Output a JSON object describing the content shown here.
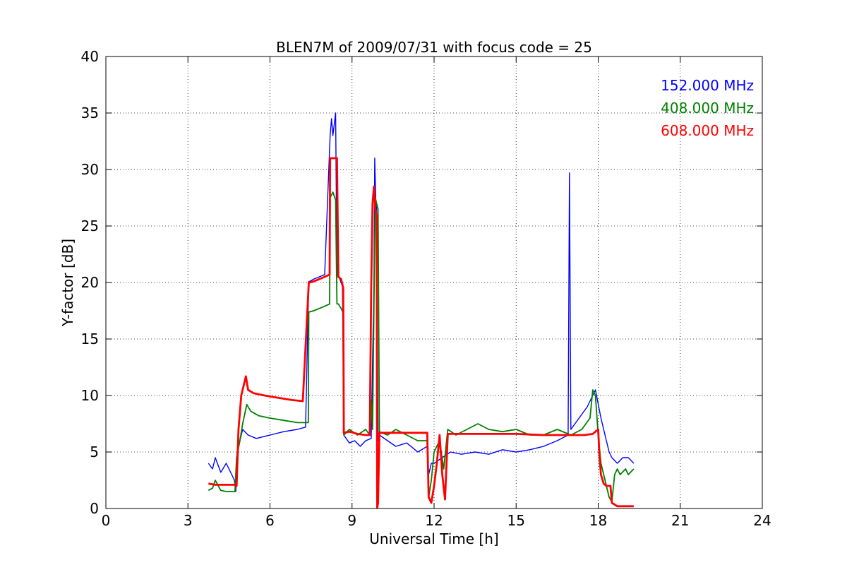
{
  "chart_data": {
    "type": "line",
    "title": "BLEN7M of 2009/07/31 with focus code = 25",
    "xlabel": "Universal Time [h]",
    "ylabel": "Y-factor [dB]",
    "xlim": [
      0,
      24
    ],
    "ylim": [
      0,
      40
    ],
    "xticks": [
      0,
      3,
      6,
      9,
      12,
      15,
      18,
      21,
      24
    ],
    "yticks": [
      0,
      5,
      10,
      15,
      20,
      25,
      30,
      35,
      40
    ],
    "grid": true,
    "legend": "top-right",
    "series": [
      {
        "name": "152.000 MHz",
        "color": "#0000ff",
        "x": [
          3.75,
          3.9,
          4.0,
          4.2,
          4.4,
          4.6,
          4.7,
          4.75,
          4.8,
          4.9,
          5.0,
          5.2,
          5.5,
          6.0,
          6.5,
          7.0,
          7.3,
          7.42,
          7.45,
          7.6,
          7.8,
          8.0,
          8.2,
          8.25,
          8.3,
          8.4,
          8.45,
          8.5,
          8.6,
          8.65,
          8.7,
          8.9,
          9.1,
          9.3,
          9.5,
          9.7,
          9.8,
          9.83,
          9.87,
          9.9,
          9.95,
          10.0,
          10.3,
          10.6,
          11.0,
          11.4,
          11.75,
          11.8,
          11.9,
          12.0,
          12.3,
          12.6,
          13.0,
          13.5,
          14.0,
          14.5,
          15.0,
          15.5,
          16.0,
          16.5,
          16.9,
          16.95,
          17.0,
          17.3,
          17.6,
          17.9,
          18.1,
          18.3,
          18.4,
          18.5,
          18.7,
          18.9,
          19.1,
          19.3
        ],
        "y": [
          4.0,
          3.5,
          4.5,
          3.2,
          4.0,
          3.0,
          2.5,
          1.5,
          5.0,
          6.0,
          7.0,
          6.5,
          6.2,
          6.5,
          6.8,
          7.0,
          7.2,
          20.1,
          20.1,
          20.3,
          20.5,
          20.7,
          33.0,
          34.5,
          33.0,
          35.0,
          20.6,
          20.6,
          20.0,
          19.6,
          6.5,
          5.8,
          6.0,
          5.5,
          6.0,
          6.2,
          20.0,
          31.0,
          27.0,
          26.5,
          6.0,
          6.5,
          6.0,
          5.5,
          5.8,
          5.0,
          5.5,
          3.0,
          4.0,
          4.0,
          4.5,
          5.0,
          4.8,
          5.0,
          4.8,
          5.2,
          5.0,
          5.2,
          5.5,
          6.0,
          6.5,
          29.7,
          7.0,
          8.0,
          9.0,
          10.5,
          8.0,
          6.0,
          5.0,
          4.5,
          4.0,
          4.5,
          4.5,
          4.0
        ]
      },
      {
        "name": "408.000 MHz",
        "color": "#008000",
        "x": [
          3.75,
          3.9,
          4.0,
          4.2,
          4.4,
          4.6,
          4.72,
          4.78,
          4.9,
          5.0,
          5.15,
          5.3,
          5.6,
          6.0,
          6.5,
          7.0,
          7.4,
          7.42,
          7.45,
          7.6,
          7.8,
          8.0,
          8.18,
          8.2,
          8.3,
          8.4,
          8.45,
          8.5,
          8.6,
          8.68,
          8.7,
          8.9,
          9.2,
          9.5,
          9.65,
          9.7,
          9.75,
          9.8,
          9.85,
          9.9,
          9.95,
          10.0,
          10.3,
          10.6,
          11.0,
          11.4,
          11.75,
          11.8,
          11.9,
          12.0,
          12.2,
          12.35,
          12.5,
          12.8,
          13.2,
          13.6,
          14.0,
          14.5,
          15.0,
          15.5,
          16.0,
          16.5,
          17.0,
          17.4,
          17.7,
          17.8,
          17.9,
          18.0,
          18.1,
          18.2,
          18.3,
          18.4,
          18.5,
          18.6,
          18.7,
          18.8,
          19.0,
          19.1,
          19.3
        ],
        "y": [
          1.6,
          1.8,
          2.5,
          1.6,
          1.5,
          1.5,
          1.5,
          4.5,
          6.0,
          7.5,
          9.2,
          8.6,
          8.2,
          8.0,
          7.8,
          7.6,
          7.6,
          17.4,
          17.4,
          17.5,
          17.7,
          17.9,
          18.1,
          27.5,
          28.0,
          27.3,
          18.1,
          18.1,
          17.7,
          17.3,
          6.5,
          7.0,
          6.5,
          7.0,
          6.5,
          9.5,
          7.0,
          18.0,
          27.5,
          27.0,
          26.5,
          6.8,
          6.5,
          7.0,
          6.5,
          6.0,
          6.0,
          1.0,
          2.5,
          5.0,
          6.0,
          3.5,
          7.0,
          6.5,
          7.0,
          7.5,
          7.0,
          6.8,
          7.0,
          6.5,
          6.5,
          7.0,
          6.5,
          7.0,
          8.0,
          10.5,
          10.0,
          6.5,
          4.0,
          3.0,
          2.0,
          1.0,
          0.6,
          3.0,
          3.5,
          3.0,
          3.5,
          3.0,
          3.5
        ]
      },
      {
        "name": "608.000 MHz",
        "color": "#ff0000",
        "x": [
          3.75,
          4.0,
          4.4,
          4.7,
          4.78,
          4.85,
          4.95,
          5.05,
          5.12,
          5.2,
          5.4,
          5.8,
          6.3,
          6.8,
          7.2,
          7.42,
          7.45,
          7.6,
          7.8,
          8.0,
          8.18,
          8.2,
          8.3,
          8.45,
          8.5,
          8.6,
          8.68,
          8.7,
          8.9,
          9.2,
          9.5,
          9.65,
          9.7,
          9.75,
          9.8,
          9.85,
          9.9,
          9.92,
          9.95,
          10.0,
          10.5,
          11.0,
          11.5,
          11.75,
          11.8,
          11.9,
          12.0,
          12.1,
          12.2,
          12.3,
          12.4,
          12.5,
          13.0,
          14.0,
          15.0,
          16.0,
          17.0,
          17.5,
          17.8,
          17.9,
          18.0,
          18.05,
          18.1,
          18.2,
          18.3,
          18.45,
          18.5,
          18.7,
          19.0,
          19.3
        ],
        "y": [
          2.2,
          2.1,
          2.1,
          2.1,
          2.0,
          7.0,
          10.0,
          11.0,
          11.7,
          10.5,
          10.2,
          10.0,
          9.8,
          9.6,
          9.5,
          20.0,
          20.0,
          20.1,
          20.3,
          20.5,
          20.7,
          31.0,
          31.0,
          31.0,
          20.5,
          20.3,
          19.5,
          6.7,
          6.8,
          6.6,
          6.5,
          6.5,
          19.5,
          27.0,
          28.5,
          26.5,
          26.0,
          0.0,
          0.5,
          6.7,
          6.7,
          6.7,
          6.7,
          6.7,
          1.0,
          0.5,
          2.0,
          4.0,
          6.5,
          3.0,
          0.8,
          6.6,
          6.6,
          6.6,
          6.6,
          6.5,
          6.5,
          6.5,
          6.6,
          6.8,
          7.0,
          4.5,
          3.0,
          2.2,
          2.0,
          2.0,
          0.5,
          0.2,
          0.2,
          0.2
        ]
      }
    ]
  }
}
